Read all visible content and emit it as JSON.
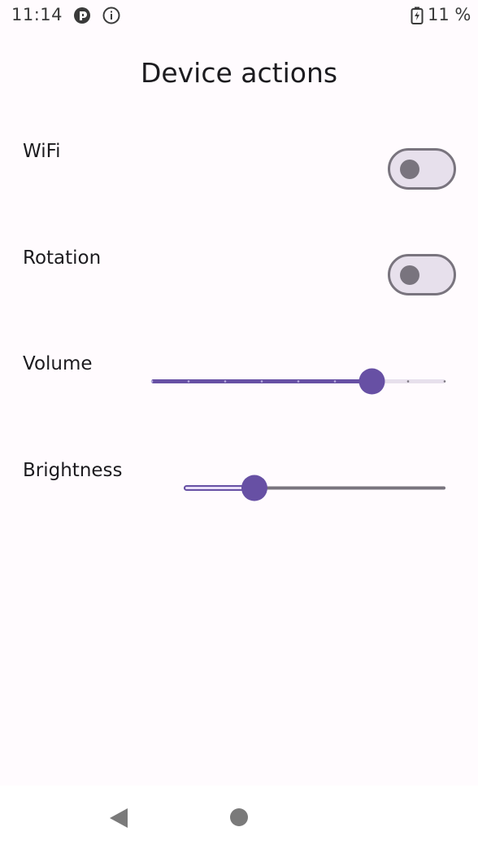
{
  "status_bar": {
    "time": "11:14",
    "battery": "11 %",
    "icons": [
      "app-notification-icon",
      "info-icon",
      "battery-charging-icon"
    ]
  },
  "title": "Device actions",
  "settings": {
    "wifi": {
      "label": "WiFi",
      "enabled": false
    },
    "rotation": {
      "label": "Rotation",
      "enabled": false
    },
    "volume": {
      "label": "Volume",
      "level_fraction": 0.75,
      "steps": 8
    },
    "brightness": {
      "label": "Brightness",
      "level_fraction": 0.27
    }
  },
  "nav_bar": {
    "icons": [
      "back-icon",
      "home-icon"
    ]
  },
  "colors": {
    "accent": "#6750a4",
    "track_inactive": "#e7e0ec",
    "switch_outline": "#79747e",
    "background": "#fffbfe"
  }
}
